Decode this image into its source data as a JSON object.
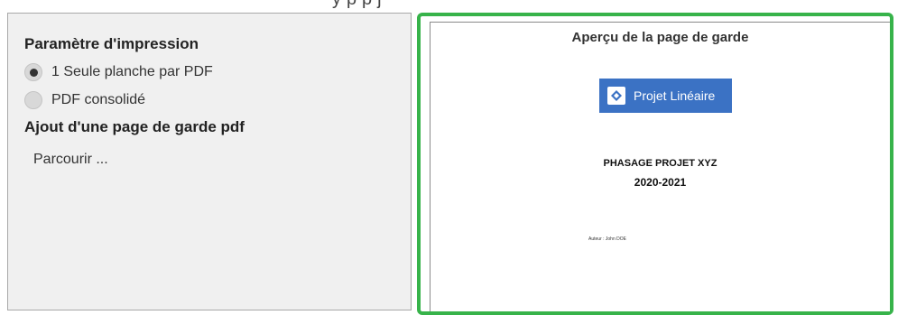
{
  "top_strip": {
    "text": "y                                          p                                p   j"
  },
  "print_settings": {
    "title": "Paramètre d'impression",
    "options": [
      {
        "label": "1 Seule planche par PDF",
        "selected": true
      },
      {
        "label": "PDF consolidé",
        "selected": false
      }
    ]
  },
  "cover_page": {
    "title": "Ajout d'une page de garde pdf",
    "browse_label": "Parcourir ..."
  },
  "preview": {
    "title": "Aperçu de la page de garde",
    "brand_label": "Projet Linéaire",
    "document_title": "PHASAGE PROJET XYZ",
    "document_years": "2020-2021",
    "author_line": "Auteur : John DOE",
    "highlight_color": "#37b34a",
    "brand_color": "#3b72c4",
    "brand_icon": "diamond-logo-icon"
  }
}
